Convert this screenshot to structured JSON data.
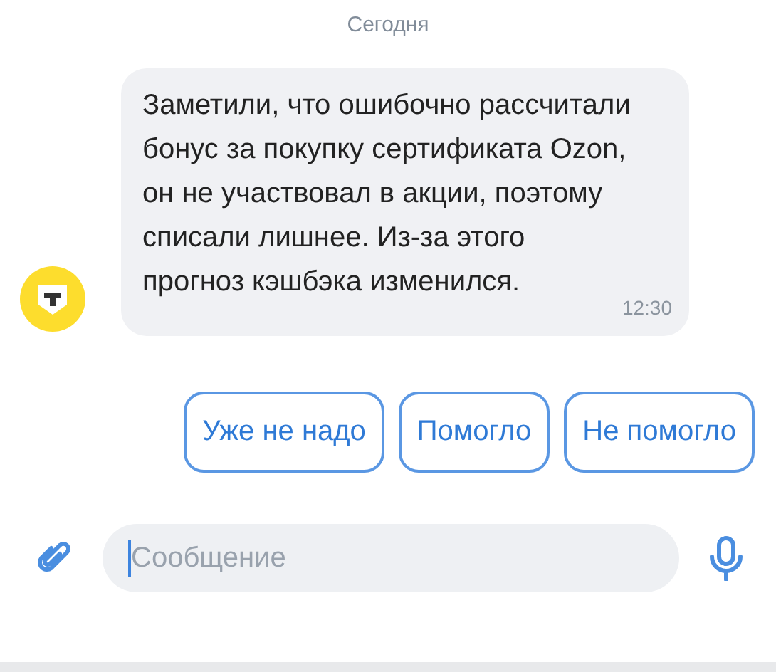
{
  "date_divider": "Сегодня",
  "message": {
    "text": "Заметили, что ошибочно рассчитали бонус за покупку сертификата Ozon, он не участвовал в акции, поэтому списали лишнее. Из-за этого прогноз кэшбэка изменился.",
    "time": "12:30"
  },
  "quick_replies": [
    "Уже не надо",
    "Помогло",
    "Не помогло"
  ],
  "composer": {
    "placeholder": "Сообщение"
  }
}
